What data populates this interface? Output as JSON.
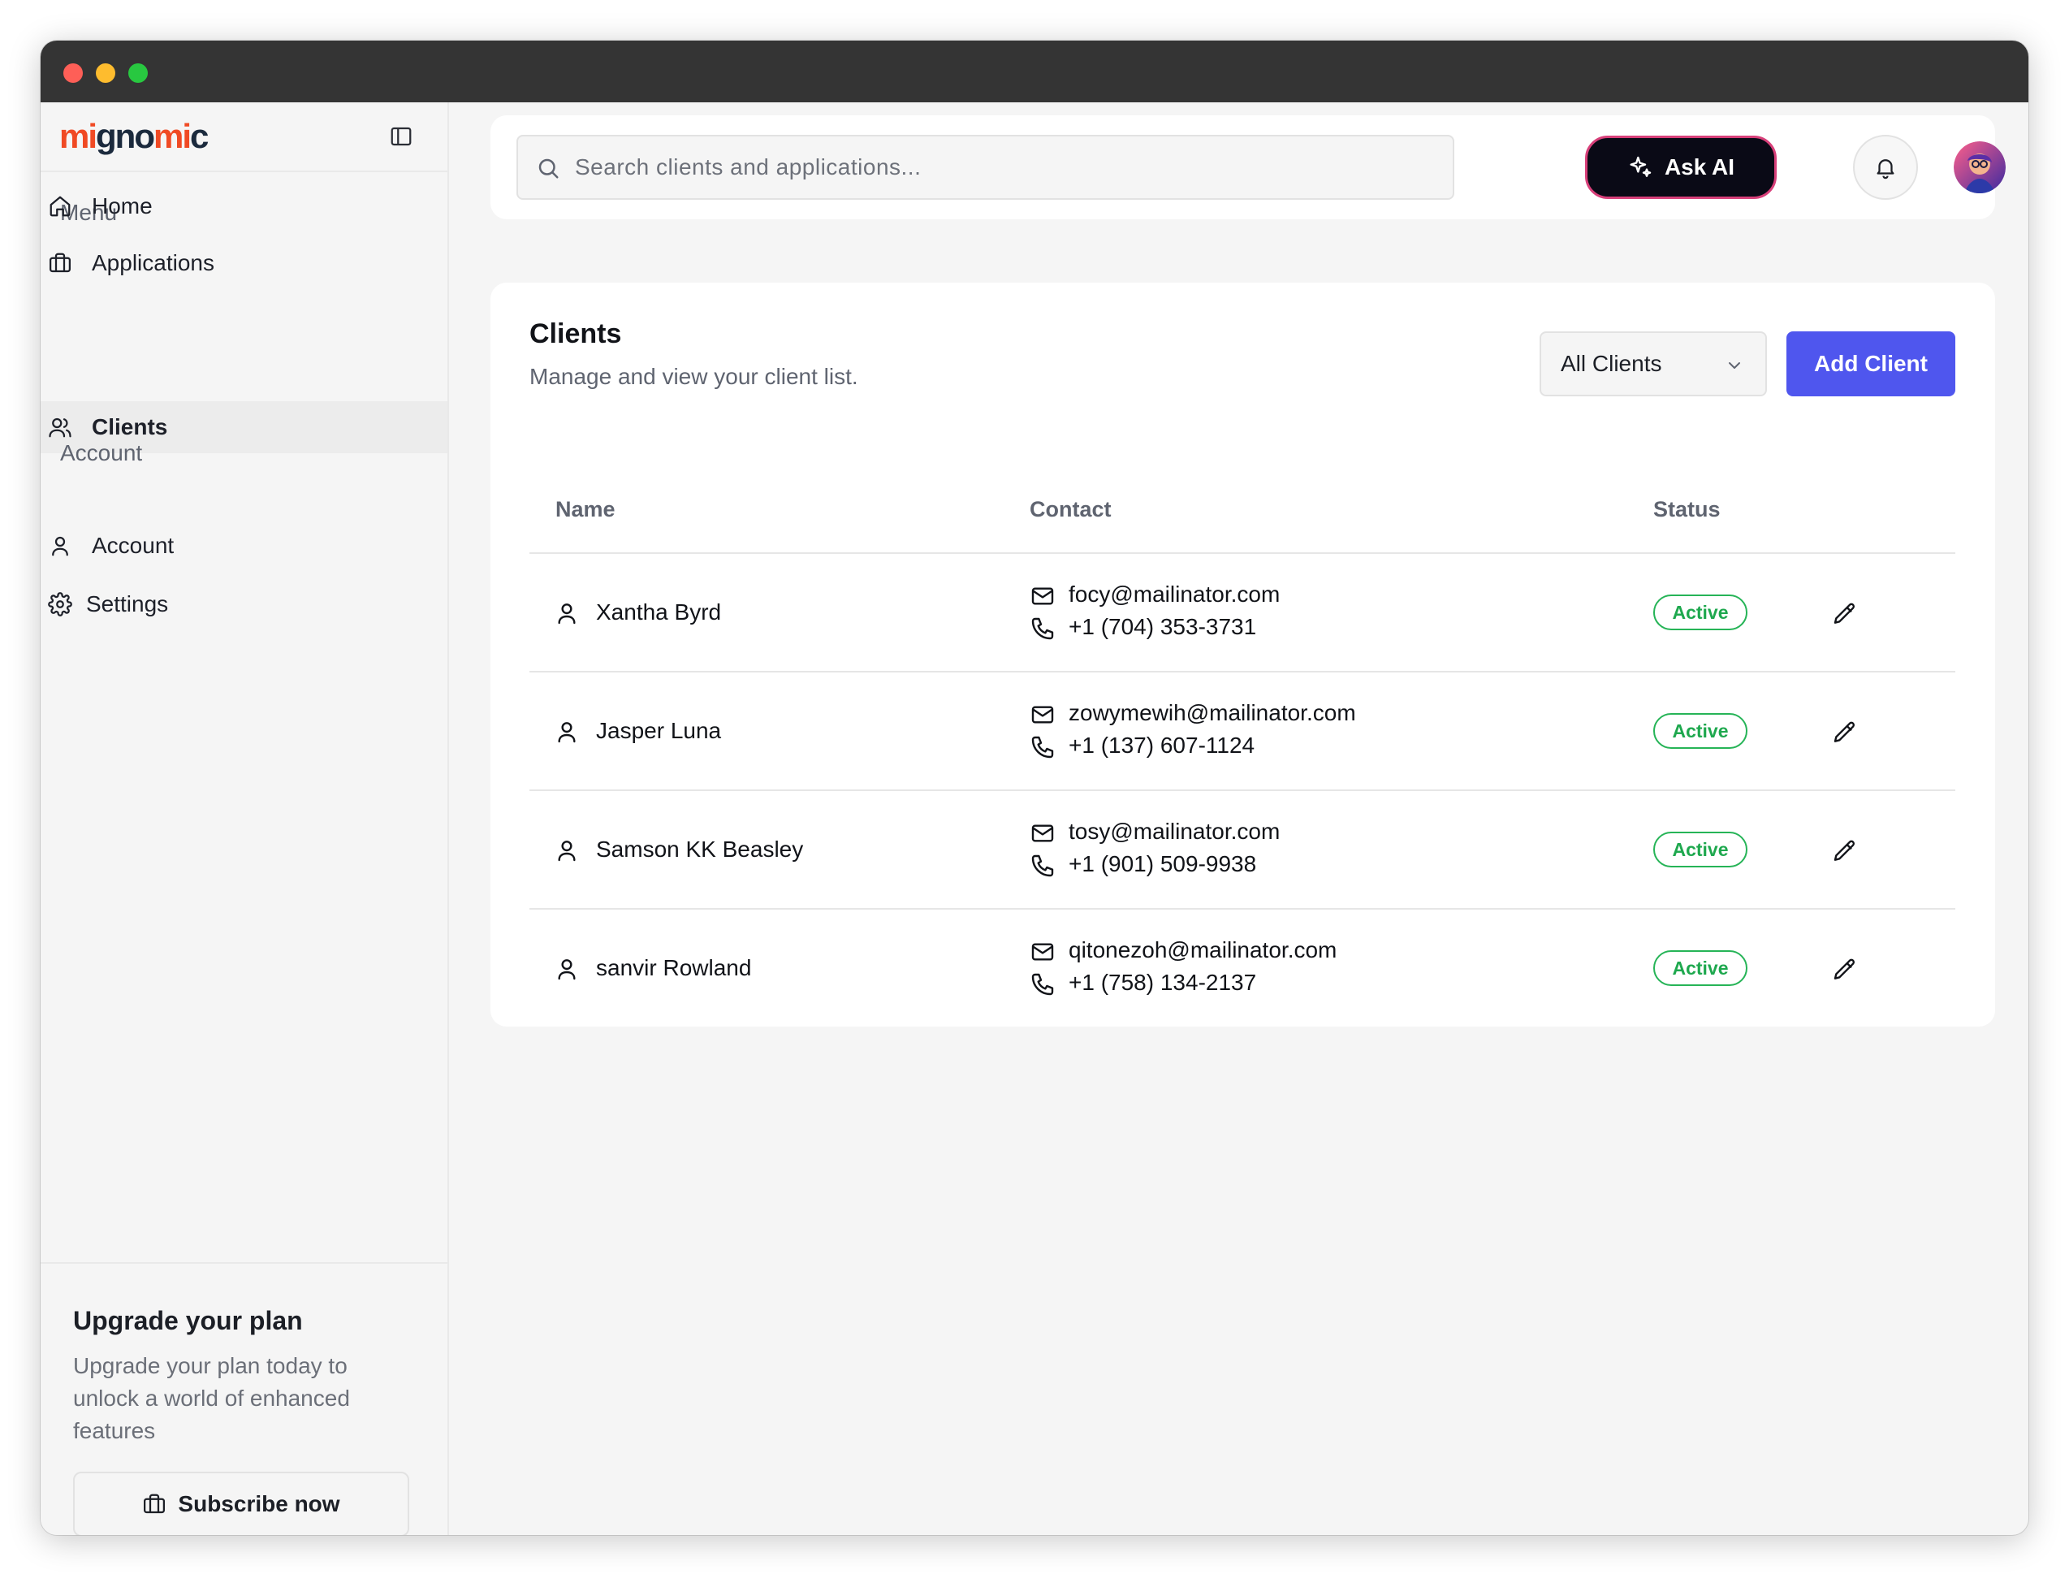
{
  "app": {
    "logo_part1": "mi",
    "logo_part2": "gno",
    "logo_part3": "mi",
    "logo_part4": "c",
    "brand_orange": "#f04a24",
    "brand_dark": "#1b2a3d"
  },
  "sidebar": {
    "menu_label": "Menu",
    "menu_items": [
      {
        "label": "Home",
        "icon": "home-icon"
      },
      {
        "label": "Applications",
        "icon": "briefcase-icon"
      },
      {
        "label": "Clients",
        "icon": "users-icon",
        "active": true
      }
    ],
    "account_label": "Account",
    "account_items": [
      {
        "label": "Account",
        "icon": "user-icon"
      },
      {
        "label": "Settings",
        "icon": "gear-icon"
      }
    ],
    "upgrade": {
      "title": "Upgrade your plan",
      "text": "Upgrade your plan today to unlock a world of enhanced features",
      "button": "Subscribe now"
    }
  },
  "topbar": {
    "search_placeholder": "Search clients and applications...",
    "ask_ai": "Ask AI"
  },
  "clients": {
    "title": "Clients",
    "subtitle": "Manage and view your client list.",
    "filter_value": "All Clients",
    "add_button": "Add Client",
    "accent": "#4f56ee",
    "columns": [
      "Name",
      "Contact",
      "Status"
    ],
    "rows": [
      {
        "name": "Xantha Byrd",
        "email": "focy@mailinator.com",
        "phone": "+1 (704) 353-3731",
        "status": "Active"
      },
      {
        "name": "Jasper Luna",
        "email": "zowymewih@mailinator.com",
        "phone": "+1 (137) 607-1124",
        "status": "Active"
      },
      {
        "name": "Samson KK Beasley",
        "email": "tosy@mailinator.com",
        "phone": "+1 (901) 509-9938",
        "status": "Active"
      },
      {
        "name": "sanvir Rowland",
        "email": "qitonezoh@mailinator.com",
        "phone": "+1 (758) 134-2137",
        "status": "Active"
      }
    ],
    "status_color": "#1ea84e"
  }
}
